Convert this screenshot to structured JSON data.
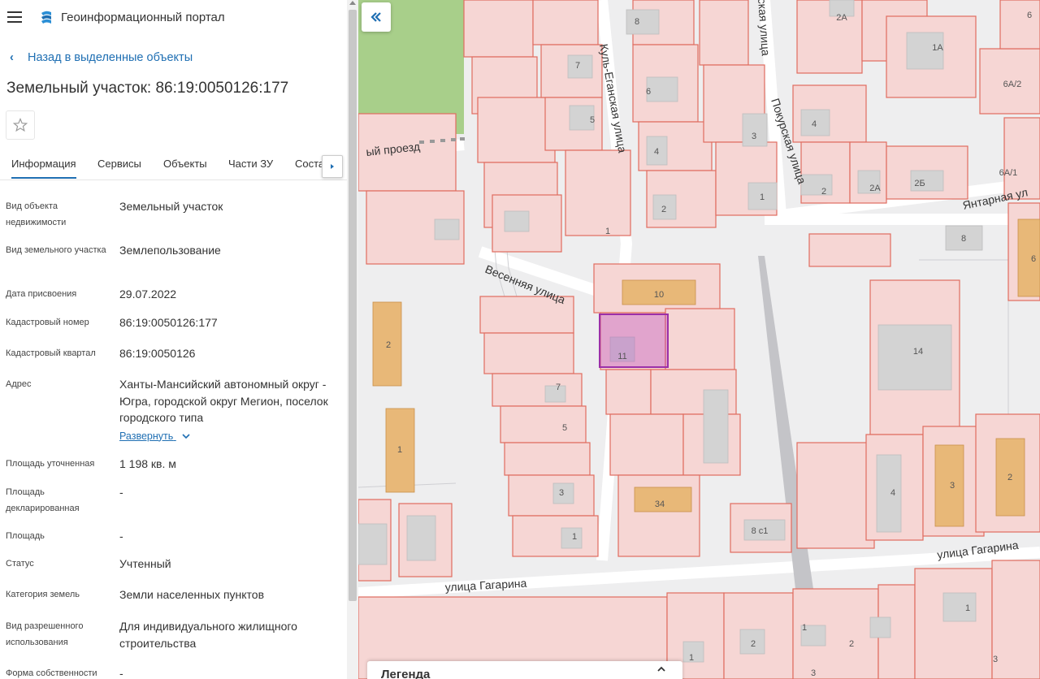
{
  "app": {
    "title": "Геоинформационный портал",
    "back_label": "Назад в выделенные объекты",
    "page_title": "Земельный участок: 86:19:0050126:177"
  },
  "tabs": [
    {
      "label": "Информация",
      "active": true
    },
    {
      "label": "Сервисы",
      "active": false
    },
    {
      "label": "Объекты",
      "active": false
    },
    {
      "label": "Части ЗУ",
      "active": false
    },
    {
      "label": "Соста",
      "active": false
    }
  ],
  "fields": [
    {
      "label": "Вид объекта недвижимости",
      "value": "Земельный участок"
    },
    {
      "label": "Вид земельного участка",
      "value": "Землепользование"
    },
    {
      "label": "Дата присвоения",
      "value": "29.07.2022"
    },
    {
      "label": "Кадастровый номер",
      "value": "86:19:0050126:177"
    },
    {
      "label": "Кадастровый квартал",
      "value": "86:19:0050126"
    },
    {
      "label": "Адрес",
      "value": "Ханты-Мансийский автономный округ - Югра, городской округ Мегион, поселок городского типа",
      "expand_label": "Развернуть"
    },
    {
      "label": "Площадь уточненная",
      "value": "1 198 кв. м"
    },
    {
      "label": "Площадь декларированная",
      "value": "-"
    },
    {
      "label": "Площадь",
      "value": "-"
    },
    {
      "label": "Статус",
      "value": "Учтенный"
    },
    {
      "label": "Категория земель",
      "value": "Земли населенных пунктов"
    },
    {
      "label": "Вид разрешенного использования",
      "value": "Для индивидуального жилищного строительства"
    },
    {
      "label": "Форма собственности",
      "value": "-"
    }
  ],
  "map": {
    "streets": [
      {
        "name": "Куль-Еганская улица"
      },
      {
        "name": "Покурская улица"
      },
      {
        "name": "ская улица"
      },
      {
        "name": "Весенняя улица"
      },
      {
        "name": "ый проезд"
      },
      {
        "name": "Янтарная ул"
      },
      {
        "name": "улица Гагарина"
      },
      {
        "name": "улица Гагарина"
      }
    ],
    "labels": [
      "8",
      "2А",
      "1А",
      "6",
      "6А/2",
      "7",
      "6",
      "5",
      "3",
      "4",
      "4",
      "2",
      "2А",
      "2Б",
      "6А/1",
      "1",
      "2",
      "1",
      "8",
      "6",
      "10",
      "11",
      "2",
      "14",
      "7",
      "5",
      "1",
      "3",
      "34",
      "4",
      "3",
      "2",
      "8 с1",
      "1",
      "1",
      "2",
      "1",
      "2",
      "1",
      "3",
      "3"
    ],
    "legend_title": "Легенда",
    "colors": {
      "parcel_fill": "#f6d6d4",
      "parcel_stroke": "#e06c5f",
      "building": "#cfcfcf",
      "building_orange": "#e8b878",
      "selected": "#9b2fa8",
      "green": "#a8cf8a"
    }
  }
}
